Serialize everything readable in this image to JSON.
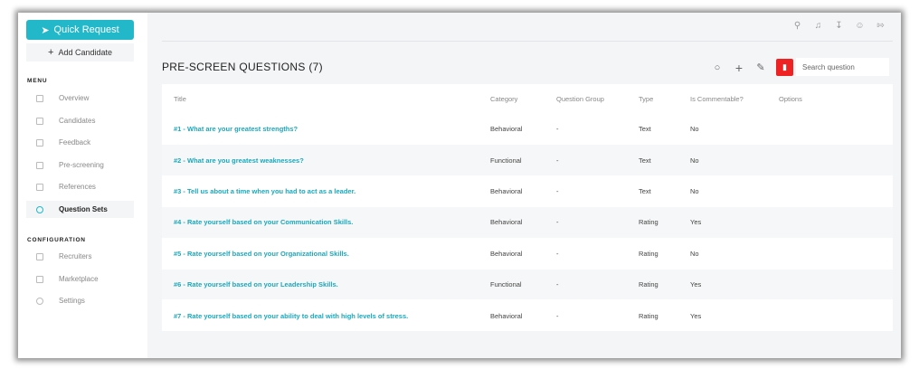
{
  "sidebar": {
    "quick_request": "Quick Request",
    "add_candidate": "Add Candidate",
    "menu_label": "MENU",
    "menu_items": [
      {
        "label": "Overview",
        "icon": "overview-icon"
      },
      {
        "label": "Candidates",
        "icon": "candidates-icon"
      },
      {
        "label": "Feedback",
        "icon": "thumbs-up-icon"
      },
      {
        "label": "Pre-screening",
        "icon": "video-icon"
      },
      {
        "label": "References",
        "icon": "references-icon"
      },
      {
        "label": "Question Sets",
        "icon": "chat-icon",
        "active": true
      }
    ],
    "config_label": "CONFIGURATION",
    "config_items": [
      {
        "label": "Recruiters",
        "icon": "users-icon"
      },
      {
        "label": "Marketplace",
        "icon": "store-icon"
      },
      {
        "label": "Settings",
        "icon": "gear-icon"
      }
    ]
  },
  "header": {
    "icons": [
      "search-icon",
      "bell-icon",
      "download-icon",
      "user-icon",
      "logout-icon"
    ]
  },
  "page": {
    "title": "PRE-SCREEN QUESTIONS (7)",
    "search_placeholder": "Search question"
  },
  "table": {
    "columns": [
      "Title",
      "Category",
      "Question Group",
      "Type",
      "Is Commentable?",
      "Options"
    ],
    "rows": [
      {
        "title": "#1 - What are your greatest strengths?",
        "category": "Behavioral",
        "group": "-",
        "type": "Text",
        "commentable": "No",
        "options": ""
      },
      {
        "title": "#2 - What are you greatest weaknesses?",
        "category": "Functional",
        "group": "-",
        "type": "Text",
        "commentable": "No",
        "options": ""
      },
      {
        "title": "#3 - Tell us about a time when you had to act as a leader.",
        "category": "Behavioral",
        "group": "-",
        "type": "Text",
        "commentable": "No",
        "options": ""
      },
      {
        "title": "#4 - Rate yourself based on your Communication Skills.",
        "category": "Behavioral",
        "group": "-",
        "type": "Rating",
        "commentable": "Yes",
        "options": ""
      },
      {
        "title": "#5 - Rate yourself based on your Organizational Skills.",
        "category": "Behavioral",
        "group": "-",
        "type": "Rating",
        "commentable": "No",
        "options": ""
      },
      {
        "title": "#6 - Rate yourself based on your Leadership Skills.",
        "category": "Functional",
        "group": "-",
        "type": "Rating",
        "commentable": "Yes",
        "options": ""
      },
      {
        "title": "#7 - Rate yourself based on your ability to deal with high levels of stress.",
        "category": "Behavioral",
        "group": "-",
        "type": "Rating",
        "commentable": "Yes",
        "options": ""
      }
    ]
  },
  "colors": {
    "accent": "#22b8c9",
    "link": "#1ba7bb",
    "danger": "#ee2222"
  }
}
